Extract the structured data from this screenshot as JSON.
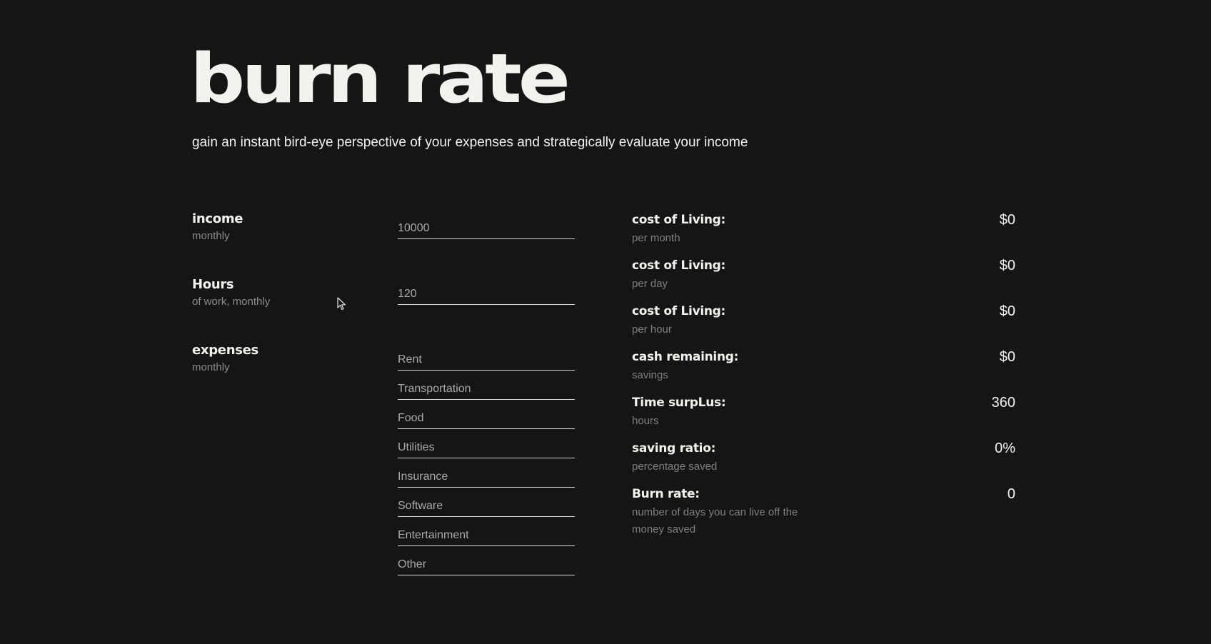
{
  "header": {
    "title": "Burn Rate",
    "subtitle": "gain an instant bird-eye perspective of your expenses and strategically evaluate your income"
  },
  "inputs": {
    "income": {
      "label": "income",
      "sub": "monthly",
      "placeholder": "10000"
    },
    "hours": {
      "label": "Hours",
      "sub": "of work, monthly",
      "placeholder": "120"
    },
    "expenses": {
      "label": "expenses",
      "sub": "monthly",
      "fields": [
        "Rent",
        "Transportation",
        "Food",
        "Utilities",
        "Insurance",
        "Software",
        "Entertainment",
        "Other"
      ]
    }
  },
  "results": [
    {
      "label": "cost of Living:",
      "sub": "per month",
      "value": "$0"
    },
    {
      "label": "cost of Living:",
      "sub": "per day",
      "value": "$0"
    },
    {
      "label": "cost of Living:",
      "sub": "per hour",
      "value": "$0"
    },
    {
      "label": "cash remaining:",
      "sub": "savings",
      "value": "$0"
    },
    {
      "label": "Time surpLus:",
      "sub": "hours",
      "value": "360"
    },
    {
      "label": "saving ratio:",
      "sub": "percentage saved",
      "value": "0%"
    },
    {
      "label": "Burn rate:",
      "sub": "number of days you can live off the money saved",
      "value": "0"
    }
  ],
  "colors": {
    "background": "#151515",
    "text": "#f2f2ee",
    "muted": "#8a8a8a",
    "underline": "#d8d8d8"
  },
  "icons": {
    "cursor": "mouse-pointer-icon"
  }
}
